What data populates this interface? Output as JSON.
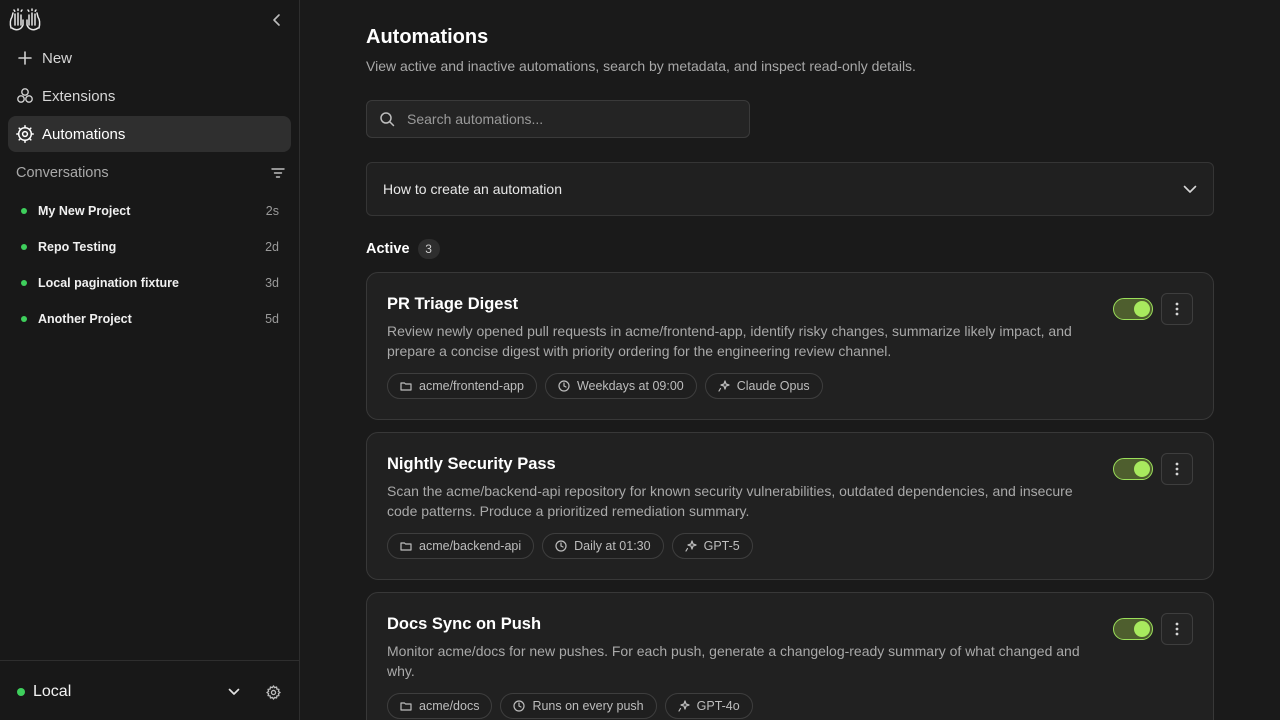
{
  "sidebar": {
    "nav": [
      {
        "label": "New",
        "icon": "plus-icon"
      },
      {
        "label": "Extensions",
        "icon": "extensions-icon"
      },
      {
        "label": "Automations",
        "icon": "automations-gear-icon"
      }
    ],
    "conversations_title": "Conversations",
    "conversations": [
      {
        "label": "My New Project",
        "time": "2s"
      },
      {
        "label": "Repo Testing",
        "time": "2d"
      },
      {
        "label": "Local pagination fixture",
        "time": "3d"
      },
      {
        "label": "Another Project",
        "time": "5d"
      }
    ],
    "environment": "Local"
  },
  "main": {
    "title": "Automations",
    "subtitle": "View active and inactive automations, search by metadata, and inspect read-only details.",
    "search_placeholder": "Search automations...",
    "howto_label": "How to create an automation",
    "section_title": "Active",
    "section_count": "3",
    "cards": [
      {
        "title": "PR Triage Digest",
        "description": "Review newly opened pull requests in acme/frontend-app, identify risky changes, summarize likely impact, and prepare a concise digest with priority ordering for the engineering review channel.",
        "repo": "acme/frontend-app",
        "schedule": "Weekdays at 09:00",
        "model": "Claude Opus",
        "enabled": true
      },
      {
        "title": "Nightly Security Pass",
        "description": "Scan the acme/backend-api repository for known security vulnerabilities, outdated dependencies, and insecure code patterns. Produce a prioritized remediation summary.",
        "repo": "acme/backend-api",
        "schedule": "Daily at 01:30",
        "model": "GPT-5",
        "enabled": true
      },
      {
        "title": "Docs Sync on Push",
        "description": "Monitor acme/docs for new pushes. For each push, generate a changelog-ready summary of what changed and why.",
        "repo": "acme/docs",
        "schedule": "Runs on every push",
        "model": "GPT-4o",
        "enabled": true
      }
    ]
  },
  "colors": {
    "accent_green": "#a8ea5e",
    "status_dot": "#3ecf5c",
    "background": "#1a1a1a",
    "sidebar": "#181818"
  }
}
